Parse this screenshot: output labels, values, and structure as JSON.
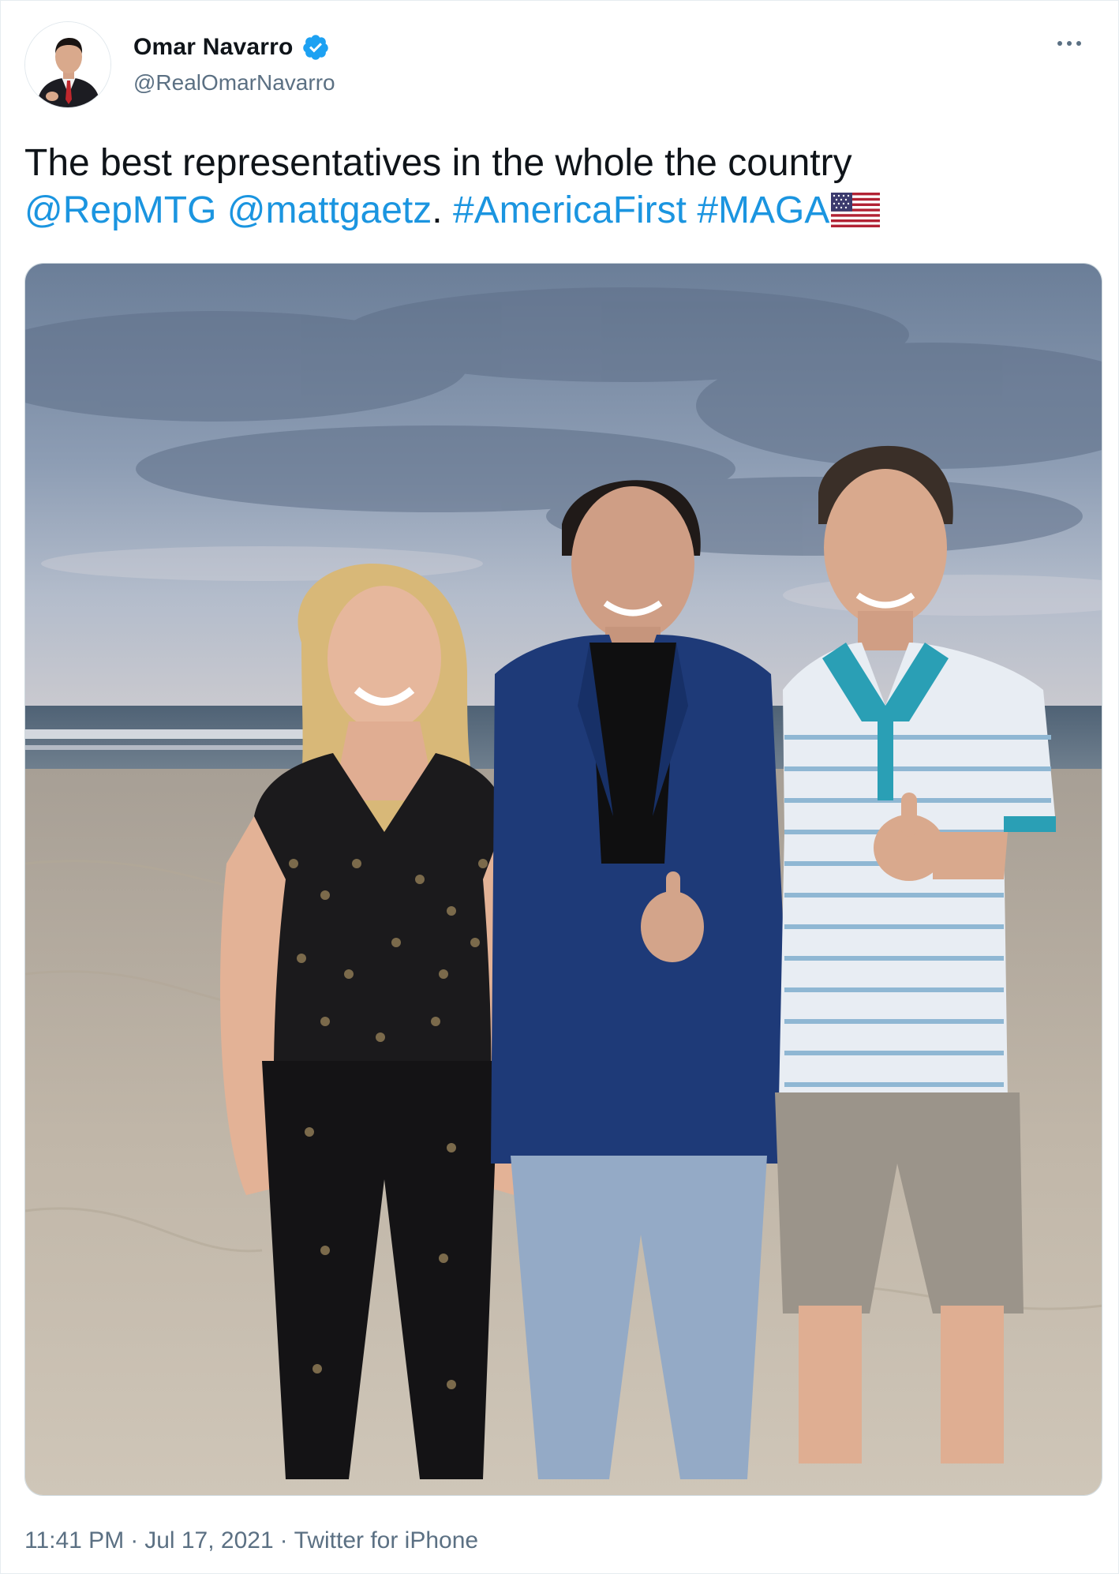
{
  "author": {
    "display_name": "Omar Navarro",
    "handle": "@RealOmarNavarro",
    "verified": true
  },
  "tweet": {
    "text_line1": "The best representatives in the whole the country",
    "mention1": "@RepMTG",
    "mention2": "@mattgaetz",
    "after_mention2": ".",
    "hashtag1": "#AmericaFirst",
    "hashtag2": "#MAGA",
    "flag_emoji": "us-flag-icon"
  },
  "photo": {
    "description_icon": "group-photo-beach"
  },
  "meta": {
    "time": "11:41 PM",
    "date": "Jul 17, 2021",
    "source": "Twitter for iPhone",
    "separator": "·"
  },
  "colors": {
    "link": "#1b95e0",
    "verified": "#1da1f2",
    "secondary_text": "#5b7083"
  }
}
